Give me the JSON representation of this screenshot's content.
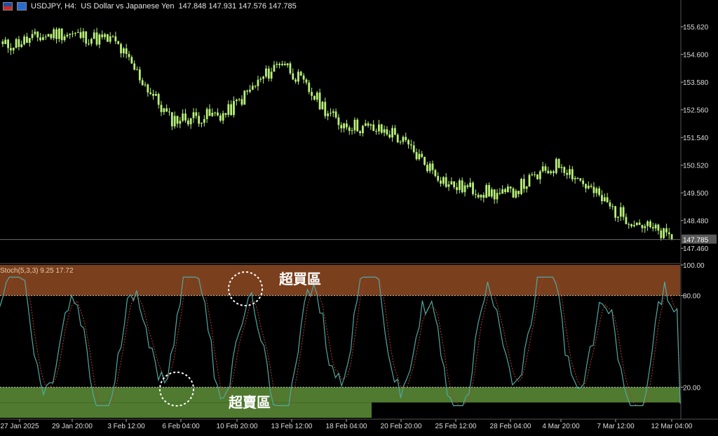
{
  "header": {
    "symbol": "USDJPY, H4:",
    "description": "US Dollar vs Japanese Yen",
    "ohlc": "147.848 147.931 147.576 147.785"
  },
  "price_axis": {
    "ticks": [
      "155.620",
      "154.600",
      "153.580",
      "152.560",
      "151.540",
      "150.520",
      "149.500",
      "148.480",
      "147.460"
    ],
    "current_price": "147.785"
  },
  "indicator": {
    "label": "Stoch(5,3,3) 9.25 17.72",
    "ticks": [
      "100.00",
      "80.00",
      "20.00"
    ],
    "overbought_label": "超買區",
    "oversold_label": "超賣區"
  },
  "time_axis": {
    "labels": [
      "27 Jan 2025",
      "29 Jan 20:00",
      "3 Feb 12:00",
      "6 Feb 04:00",
      "10 Feb 20:00",
      "13 Feb 12:00",
      "18 Feb 04:00",
      "20 Feb 20:00",
      "25 Feb 12:00",
      "28 Feb 04:00",
      "4 Mar 20:00",
      "7 Mar 12:00",
      "12 Mar 04:00"
    ]
  },
  "colors": {
    "background": "#000000",
    "candle": "#b8f07a",
    "overbought_band": "#7a3f1d",
    "oversold_band": "#4f7a2f",
    "stoch_main": "#4fa9a2",
    "stoch_signal": "#c0392b",
    "price_line": "#6b6b6b"
  },
  "chart_data": [
    {
      "type": "candlestick",
      "title": "USDJPY, H4",
      "ylim": [
        147.0,
        156.4
      ],
      "close_path_x": [
        "27 Jan 2025",
        "29 Jan 20:00",
        "3 Feb 12:00",
        "6 Feb 04:00",
        "10 Feb 20:00",
        "13 Feb 12:00",
        "18 Feb 04:00",
        "20 Feb 20:00",
        "25 Feb 12:00",
        "28 Feb 04:00",
        "4 Mar 20:00",
        "7 Mar 12:00",
        "12 Mar 04:00"
      ],
      "close_path": [
        154.9,
        155.4,
        155.1,
        152.2,
        152.4,
        154.4,
        152.1,
        151.7,
        149.8,
        149.4,
        150.6,
        148.8,
        147.8
      ],
      "last_price": 147.785
    },
    {
      "type": "line",
      "title": "Stoch(5,3,3)",
      "ylim": [
        0,
        100
      ],
      "levels": [
        80,
        20
      ],
      "main_value": 9.25,
      "signal_value": 17.72
    }
  ]
}
